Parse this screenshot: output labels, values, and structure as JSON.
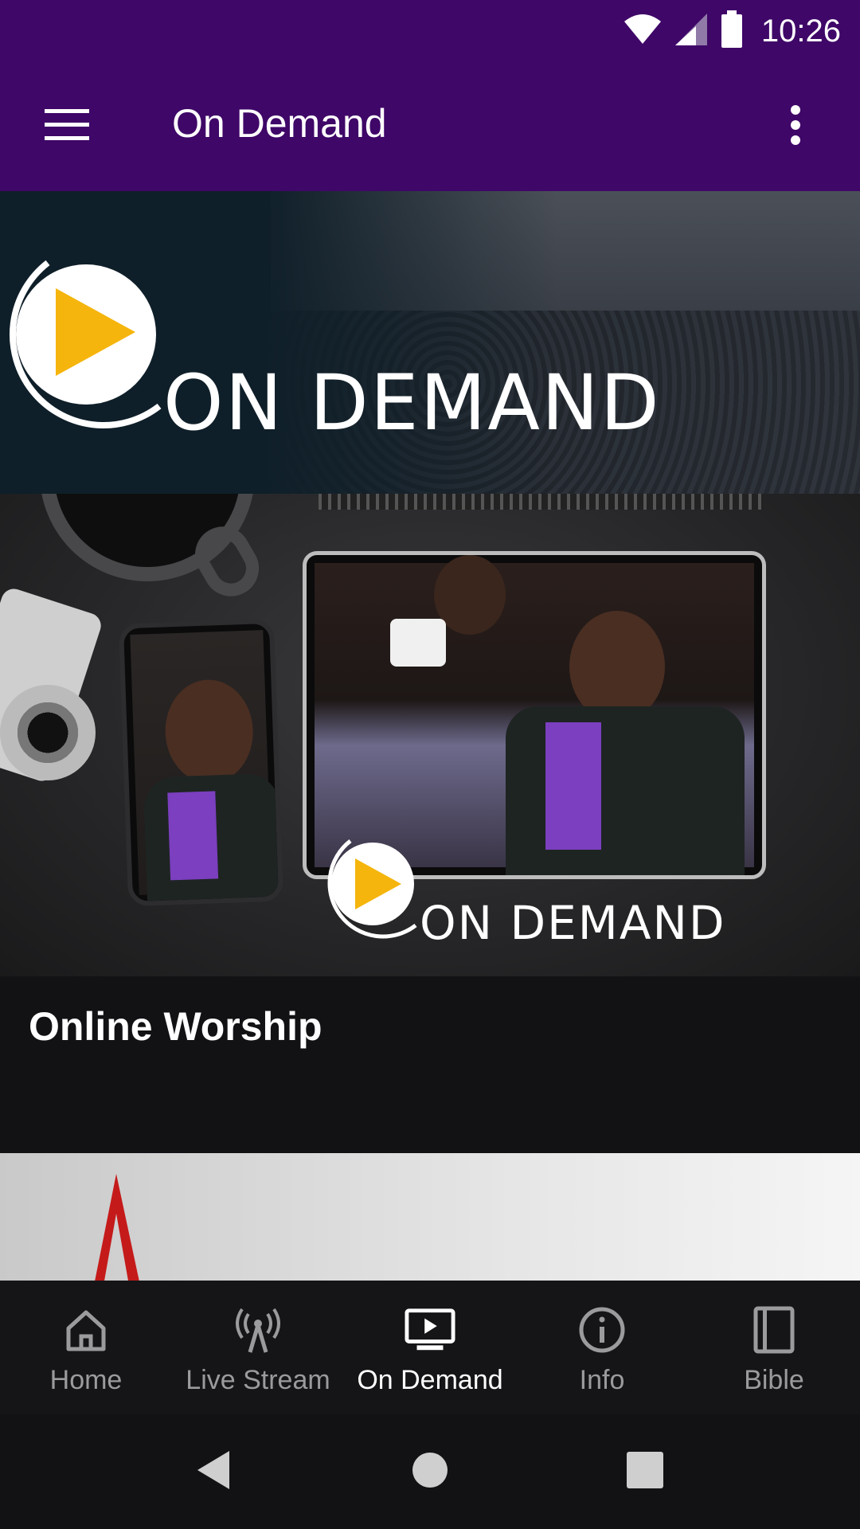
{
  "status_bar": {
    "time": "10:26",
    "icons": [
      "wifi-icon",
      "cell-signal-icon",
      "battery-icon"
    ]
  },
  "app_bar": {
    "title": "On Demand",
    "menu_icon": "hamburger-menu-icon",
    "overflow_icon": "more-vert-icon",
    "background": "#3f0768"
  },
  "banner": {
    "title": "ON DEMAND",
    "logo_icon": "play-circle-icon"
  },
  "media_card": {
    "image_overlay_title": "ON DEMAND",
    "title": "Online Worship"
  },
  "bottom_nav": {
    "items": [
      {
        "label": "Home",
        "icon": "home-icon",
        "active": false
      },
      {
        "label": "Live Stream",
        "icon": "broadcast-tower-icon",
        "active": false
      },
      {
        "label": "On Demand",
        "icon": "tv-play-icon",
        "active": true
      },
      {
        "label": "Info",
        "icon": "info-icon",
        "active": false
      },
      {
        "label": "Bible",
        "icon": "book-icon",
        "active": false
      }
    ]
  },
  "system_nav": {
    "buttons": [
      "back-icon",
      "home-circle-icon",
      "recents-icon"
    ]
  },
  "colors": {
    "accent_purple": "#3f0768",
    "play_yellow": "#f5b50d",
    "surface_dark": "#121215"
  }
}
